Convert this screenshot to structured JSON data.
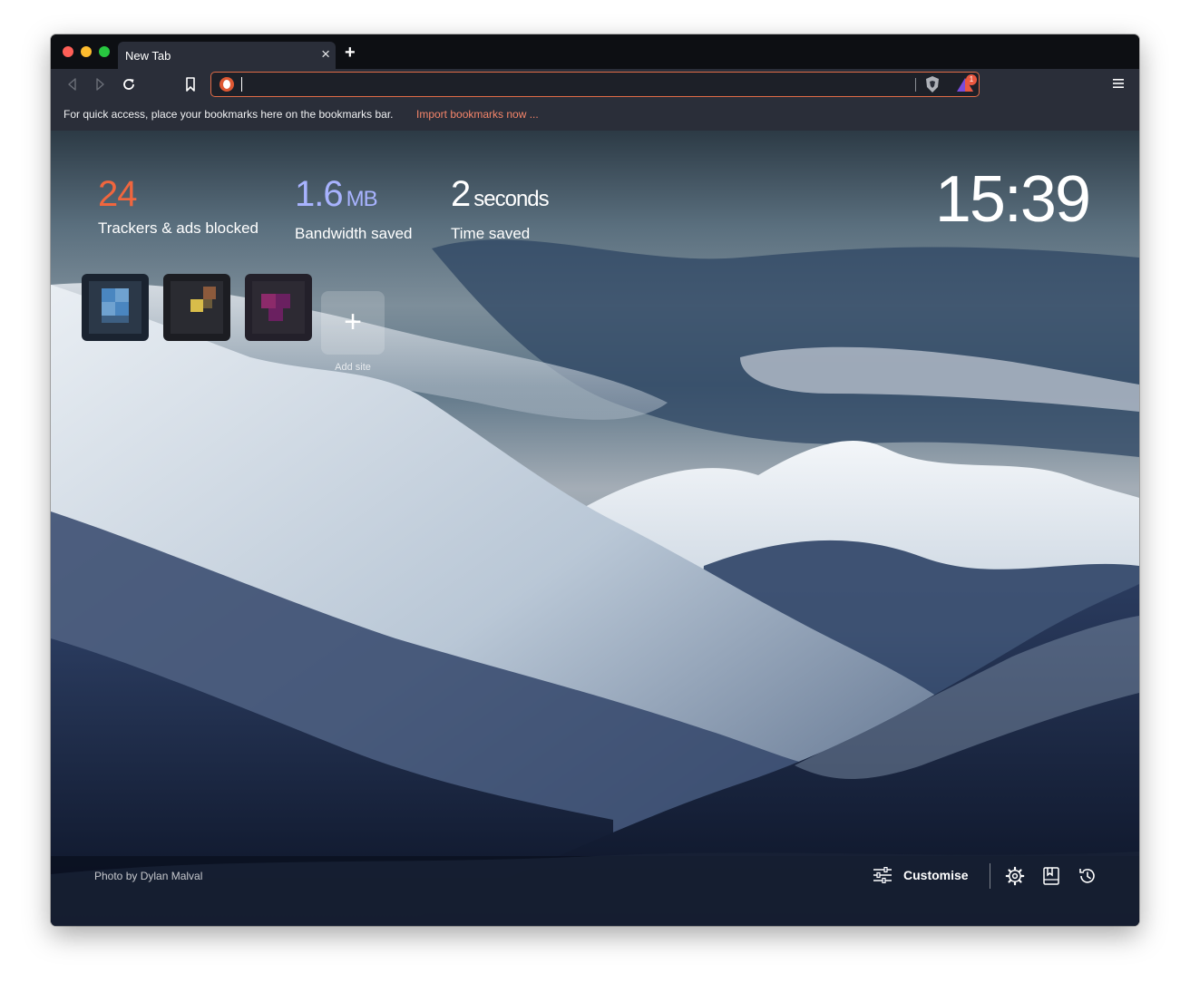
{
  "window": {
    "tab": {
      "title": "New Tab",
      "close_glyph": "×"
    },
    "new_tab_glyph": "+"
  },
  "toolbar": {
    "icons": [
      "back-icon",
      "forward-icon",
      "reload-icon",
      "bookmark-icon",
      "duckduckgo-icon",
      "brave-shields-icon",
      "brave-rewards-icon",
      "hamburger-menu-icon"
    ],
    "address_value": "",
    "rewards_badge": "1"
  },
  "bookmarks_bar": {
    "message": "For quick access, place your bookmarks here on the bookmarks bar.",
    "import_link": "Import bookmarks now ..."
  },
  "stats": {
    "trackers": {
      "value": "24",
      "label": "Trackers & ads blocked",
      "color": "#f0663e"
    },
    "bandwidth": {
      "value": "1.6",
      "unit": "MB",
      "label": "Bandwidth saved",
      "color": "#a8b3ff"
    },
    "time": {
      "value": "2",
      "unit": "seconds",
      "label": "Time saved",
      "color": "#ffffff"
    }
  },
  "clock": "15:39",
  "top_sites": {
    "tiles": [
      {
        "name": "top-site-1",
        "colors": [
          "#1a2330",
          "#4a86c0",
          "#6fa2d0",
          "#2b3848"
        ]
      },
      {
        "name": "top-site-2",
        "colors": [
          "#1c1d22",
          "#d8bd4a",
          "#8c5a3c",
          "#2a2b31"
        ]
      },
      {
        "name": "top-site-3",
        "colors": [
          "#23202a",
          "#8c2a6a",
          "#6a2060",
          "#2d2a33"
        ]
      }
    ],
    "add_label": "Add site",
    "add_glyph": "+"
  },
  "footer": {
    "photo_credit": "Photo by Dylan Malval",
    "customise_label": "Customise",
    "icons": [
      "customise-sliders-icon",
      "settings-gear-icon",
      "bookmarks-icon",
      "history-icon"
    ]
  },
  "colors": {
    "accent": "#e06b47",
    "link": "#f5856a",
    "toolbar": "#2a2e39",
    "tabstrip": "#0d0f13"
  }
}
